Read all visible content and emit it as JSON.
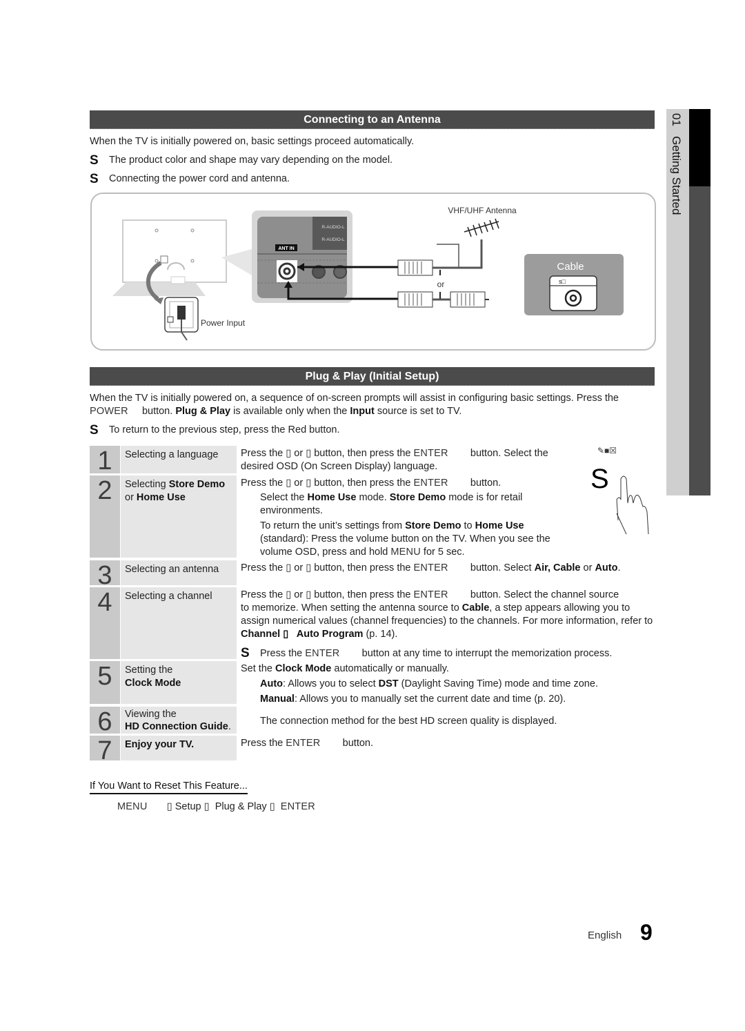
{
  "sidebar": {
    "chapter_number": "01",
    "chapter_title": "Getting Started"
  },
  "section1": {
    "title": "Connecting to an Antenna",
    "intro": "When the TV is initially powered on, basic settings proceed automatically.",
    "notes": [
      "The product color and shape may vary depending on the model.",
      "Connecting the power cord and antenna."
    ],
    "note_glyph": "S",
    "diagram": {
      "ant_in_label": "ANT IN",
      "audio_label_1": "R-AUDIO-L",
      "audio_label_2": "R-AUDIO-L",
      "power_input_label": "Power Input",
      "antenna_label": "VHF/UHF Antenna",
      "or_label": "or",
      "cable_label": "Cable",
      "cable_box_label": "s□"
    }
  },
  "section2": {
    "title": "Plug & Play (Initial Setup)",
    "intro_line1": "When the TV is initially powered on, a sequence of on-screen prompts will assist in configuring basic settings. Press the",
    "intro_line2": {
      "key": "POWER",
      "t1": "button. ",
      "b1": "Plug & Play",
      "t2": " is available only when the ",
      "b2": "Input",
      "t3": " source is set to TV."
    },
    "note": "To return to the previous step, press the Red button.",
    "note_glyph": "S",
    "hand_glyph": "S",
    "hand_icons": "✎■☒"
  },
  "steps": [
    {
      "number": "1",
      "title_plain": "Selecting a language",
      "lines": [
        {
          "parts": [
            "Press the ▯   or ▯   button, then press the ",
            "ENTER",
            "        button. Select the"
          ]
        },
        {
          "parts": [
            "desired OSD (On Screen Display) language."
          ]
        }
      ]
    },
    {
      "number": "2",
      "title_plain": "Selecting ",
      "title_bold": "Store Demo",
      "title_line2_plain": "or ",
      "title_line2_bold": "Home Use",
      "line1": [
        "Press the ▯   or ▯   button, then press the ",
        "ENTER",
        "        button."
      ],
      "sub1": {
        "t1": "Select the ",
        "b1": "Home Use",
        "t2": " mode. ",
        "b2": "Store Demo",
        "t3": " mode is for retail"
      },
      "sub1b": "environments.",
      "sub2": {
        "t1": "To return the unit’s settings from ",
        "b1": "Store Demo",
        "t2": " to ",
        "b2": "Home Use"
      },
      "sub2b": "(standard): Press the volume button on the TV. When you see the",
      "sub2c": {
        "t1": "volume OSD, press and hold ",
        "k1": "MENU",
        "t2": " for 5 sec."
      }
    },
    {
      "number": "3",
      "title_plain": "Selecting an antenna",
      "line1": {
        "t1": "Press the ▯   or ▯   button, then press the ",
        "k1": "ENTER",
        "t2": "        button. Select ",
        "b1": "Air, Cable",
        "t3": " or ",
        "b2": "Auto",
        "t4": "."
      }
    },
    {
      "number": "4",
      "title_plain": "Selecting a channel",
      "line1": {
        "t1": "Press the ▯   or ▯   button, then press the ",
        "k1": "ENTER",
        "t2": "        button. Select the channel source"
      },
      "line2": {
        "t1": "to memorize. When setting the antenna source to ",
        "b1": "Cable",
        "t2": ", a step appears allowing you to"
      },
      "line3": "assign numerical values (channel frequencies) to the channels. For more information, refer to",
      "line4": {
        "b1": "Channel ▯   Auto Program",
        "t1": " (p. 14)."
      },
      "note": {
        "t1": "Press the ",
        "k1": "ENTER",
        "t2": "        button at any time to interrupt the memorization process."
      }
    },
    {
      "number": "5",
      "title_line1": "Setting the",
      "title_bold": "Clock Mode",
      "line1": {
        "t1": "Set the ",
        "b1": "Clock Mode",
        "t2": " automatically or manually."
      },
      "sub1": {
        "b1": "Auto",
        "t1": ": Allows you to select ",
        "b2": "DST",
        "t2": " (Daylight Saving Time) mode and time zone."
      },
      "sub2": {
        "b1": "Manual",
        "t1": ": Allows you to manually set the current date and time (p. 20)."
      }
    },
    {
      "number": "6",
      "title_line1": "Viewing the",
      "title_bold": "HD Connection Guide",
      "title_tail": ".",
      "line1": "The connection method for the best HD screen quality is displayed."
    },
    {
      "number": "7",
      "title_bold": "Enjoy your TV.",
      "line1": {
        "t1": "Press the ",
        "k1": "ENTER",
        "t2": "        button."
      }
    }
  ],
  "reset": {
    "heading": "If You Want to Reset This Feature...",
    "path": {
      "k1": "MENU",
      "sep": "▯",
      "p1": "Setup",
      "p2": "Plug & Play",
      "k2": "ENTER"
    }
  },
  "footer": {
    "language": "English",
    "page_number": "9"
  }
}
